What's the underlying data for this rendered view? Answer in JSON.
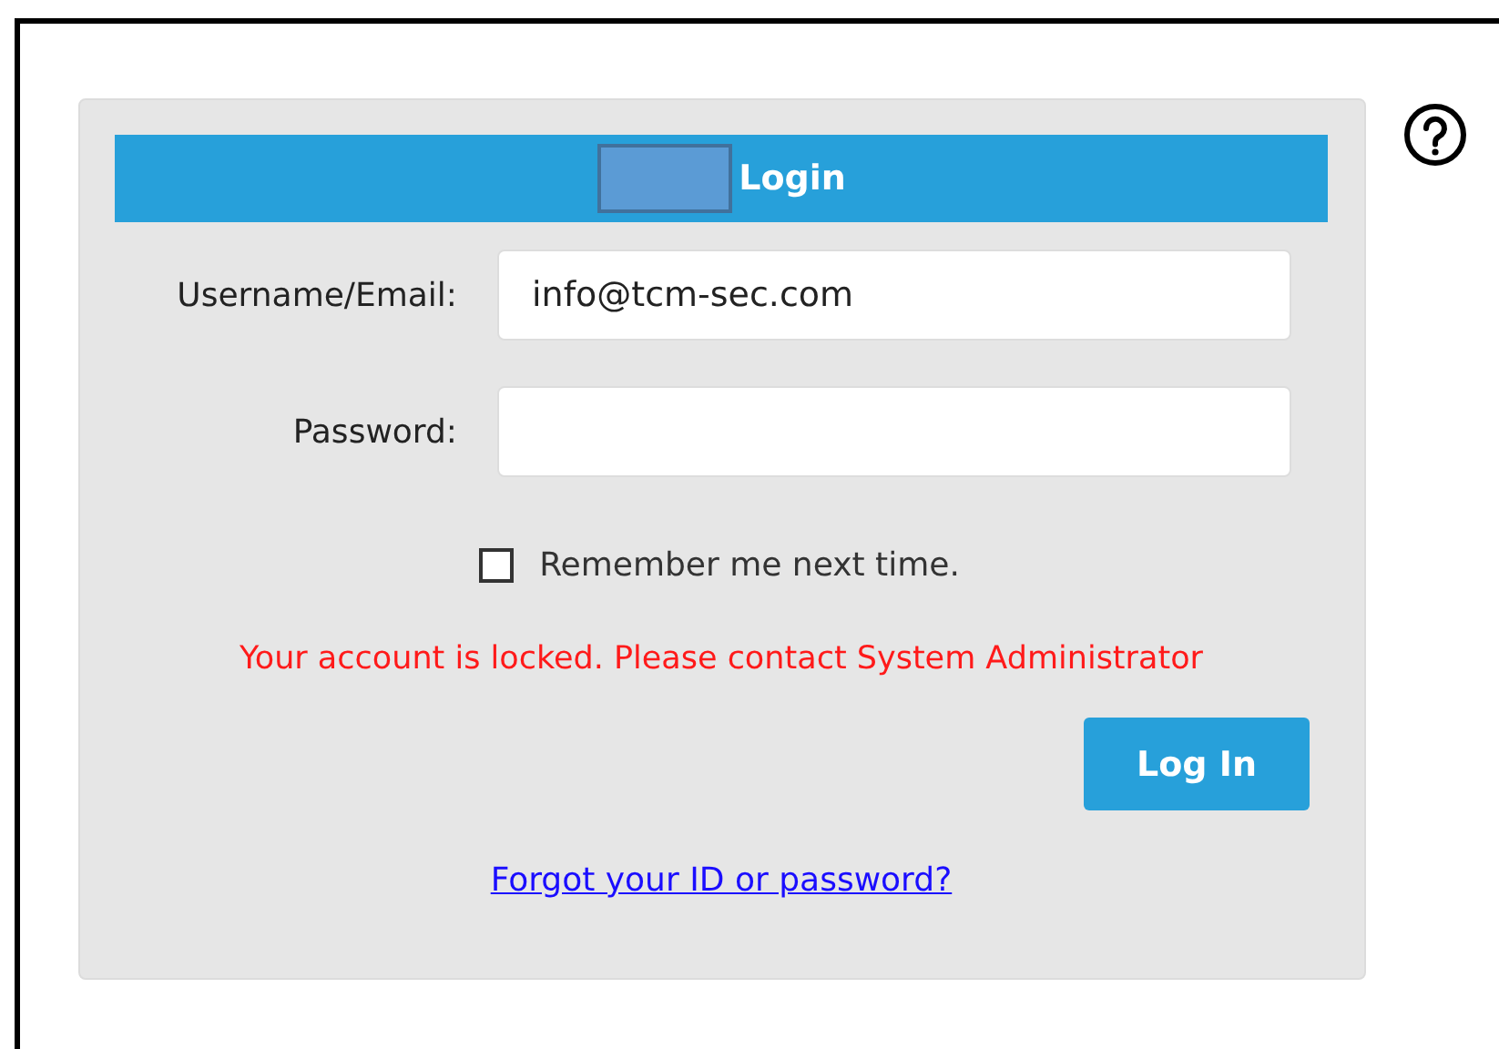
{
  "header": {
    "title": "Login"
  },
  "fields": [
    {
      "label": "Username/Email:",
      "value": "info@tcm-sec.com",
      "kind": "text"
    },
    {
      "label": "Password:",
      "kind": "password"
    }
  ],
  "remember": {
    "label": "Remember me next time.",
    "checked": false
  },
  "error": "Your account is locked. Please contact System Administrator",
  "login_button": "Log In",
  "forgot_link": "Forgot your ID or password?"
}
